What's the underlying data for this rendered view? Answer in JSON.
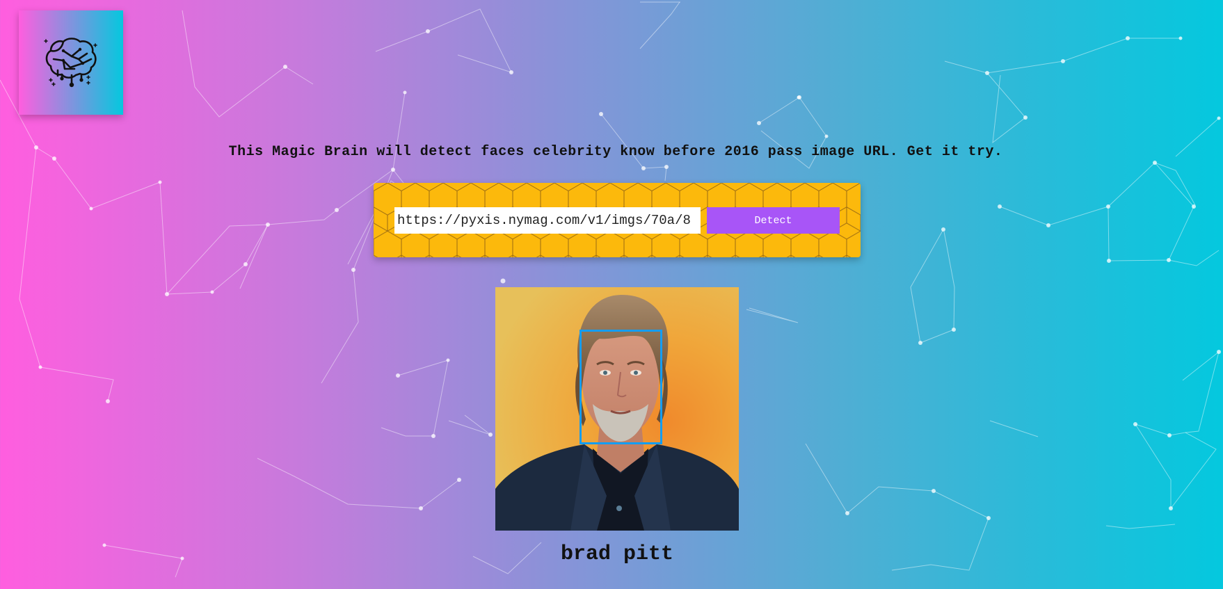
{
  "logo": {
    "icon": "brain-circuit-icon"
  },
  "intro": {
    "text": "This Magic Brain will detect faces celebrity know before 2016 pass image URL. Get it try."
  },
  "form": {
    "input_value": "https://pyxis.nymag.com/v1/imgs/70a/8",
    "detect_label": "Detect"
  },
  "result": {
    "celebrity_name": "brad pitt",
    "face_box_color": "#149df2"
  },
  "colors": {
    "gradient_left": "#ff5edf",
    "gradient_right": "#04c8de",
    "panel_bg": "#fcb90c",
    "button_bg": "#a855f7"
  }
}
